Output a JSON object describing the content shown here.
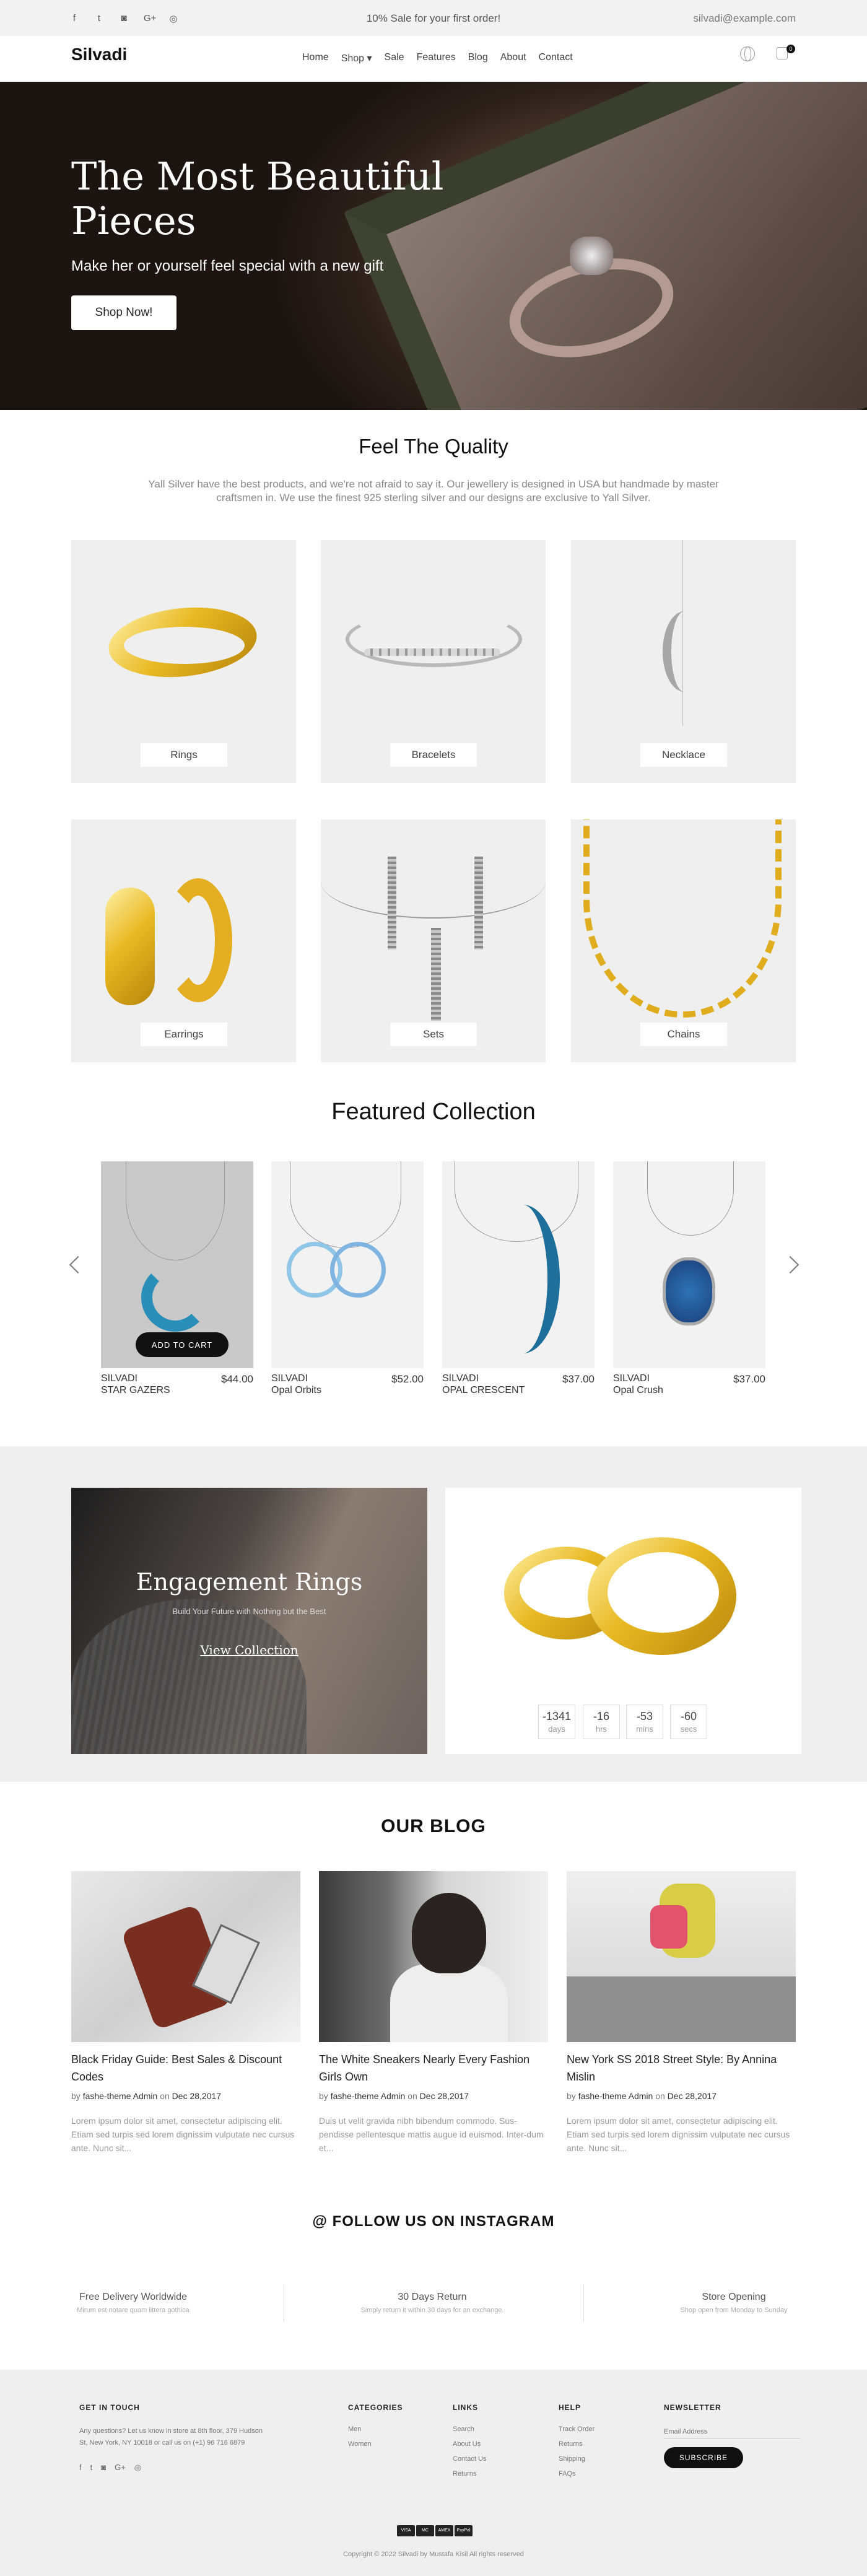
{
  "topbar": {
    "socials": [
      {
        "icon": "facebook-icon",
        "glyph": "f"
      },
      {
        "icon": "twitter-icon",
        "glyph": "t"
      },
      {
        "icon": "instagram-icon",
        "glyph": "◙"
      },
      {
        "icon": "google-plus-icon",
        "glyph": "G+"
      },
      {
        "icon": "instagram-icon",
        "glyph": "◎"
      }
    ],
    "promo": "10% Sale for your first order!",
    "email": "silvadi@example.com"
  },
  "header": {
    "logo": "Silvadi",
    "nav": [
      "Home",
      "Shop ▾",
      "Sale",
      "Features",
      "Blog",
      "About",
      "Contact"
    ],
    "cart_count": "0"
  },
  "hero": {
    "title": "The Most Beautiful Pieces",
    "subtitle": "Make her or yourself feel special with a new gift",
    "button": "Shop Now!"
  },
  "quality": {
    "title": "Feel The Quality",
    "description": "Yall Silver have the best products, and we're not afraid to say it. Our jewellery is designed in USA but handmade by master craftsmen in. We use the finest 925 sterling silver and our designs are exclusive to Yall Silver.",
    "categories": [
      "Rings",
      "Bracelets",
      "Necklace",
      "Earrings",
      "Sets",
      "Chains"
    ]
  },
  "featured": {
    "title": "Featured Collection",
    "add_to_cart": "ADD TO CART",
    "products": [
      {
        "brand": "SILVADI",
        "name": "STAR GAZERS",
        "price": "$44.00"
      },
      {
        "brand": "SILVADI",
        "name": "Opal Orbits",
        "price": "$52.00"
      },
      {
        "brand": "SILVADI",
        "name": "OPAL CRESCENT",
        "price": "$37.00"
      },
      {
        "brand": "SILVADI",
        "name": "Opal Crush",
        "price": "$37.00"
      }
    ]
  },
  "promo": {
    "title": "Engagement Rings",
    "tagline": "Build Your Future with Nothing but the Best",
    "link": "View Collection",
    "countdown": [
      {
        "value": "-1341",
        "unit": "days"
      },
      {
        "value": "-16",
        "unit": "hrs"
      },
      {
        "value": "-53",
        "unit": "mins"
      },
      {
        "value": "-60",
        "unit": "secs"
      }
    ]
  },
  "blog": {
    "title": "OUR BLOG",
    "posts": [
      {
        "title": "Black Friday Guide: Best Sales & Discount Codes",
        "by": "by",
        "author": "fashe-theme Admin",
        "on": "on",
        "date": "Dec 28,2017",
        "excerpt": "Lorem ipsum dolor sit amet, consectetur adipiscing elit. Etiam sed turpis sed lorem dignissim vulputate nec cursus ante. Nunc sit..."
      },
      {
        "title": "The White Sneakers Nearly Every Fashion Girls Own",
        "by": "by",
        "author": "fashe-theme Admin",
        "on": "on",
        "date": "Dec 28,2017",
        "excerpt": "Duis ut velit gravida nibh bibendum commodo. Sus-pendisse pellentesque mattis augue id euismod. Inter-dum et..."
      },
      {
        "title": "New York SS 2018 Street Style: By Annina Mislin",
        "by": "by",
        "author": "fashe-theme Admin",
        "on": "on",
        "date": "Dec 28,2017",
        "excerpt": "Lorem ipsum dolor sit amet, consectetur adipiscing elit. Etiam sed turpis sed lorem dignissim vulputate nec cursus ante. Nunc sit..."
      }
    ]
  },
  "instagram": {
    "title": "@ FOLLOW US ON INSTAGRAM"
  },
  "features": [
    {
      "title": "Free Delivery Worldwide",
      "sub": "Mirum est notare quam littera gothica"
    },
    {
      "title": "30 Days Return",
      "sub": "Simply return it within 30 days for an exchange."
    },
    {
      "title": "Store Opening",
      "sub": "Shop open from Monday to Sunday"
    }
  ],
  "footer": {
    "get_in_touch": {
      "title": "GET IN TOUCH",
      "text": "Any questions? Let us know in store at 8th floor, 379 Hudson St, New York, NY 10018 or call us on (+1) 96 716 6879"
    },
    "categories": {
      "title": "CATEGORIES",
      "items": [
        "Men",
        "Women"
      ]
    },
    "links": {
      "title": "LINKS",
      "items": [
        "Search",
        "About Us",
        "Contact Us",
        "Returns"
      ]
    },
    "help": {
      "title": "HELP",
      "items": [
        "Track Order",
        "Returns",
        "Shipping",
        "FAQs"
      ]
    },
    "newsletter": {
      "title": "NEWSLETTER",
      "placeholder": "Email Address",
      "button": "SUBSCRIBE"
    },
    "payments": [
      "VISA",
      "MC",
      "AMEX",
      "PayPal"
    ],
    "copyright": "Copyright © 2022 Silvadi by Mustafa Kisil All rights reserved"
  }
}
